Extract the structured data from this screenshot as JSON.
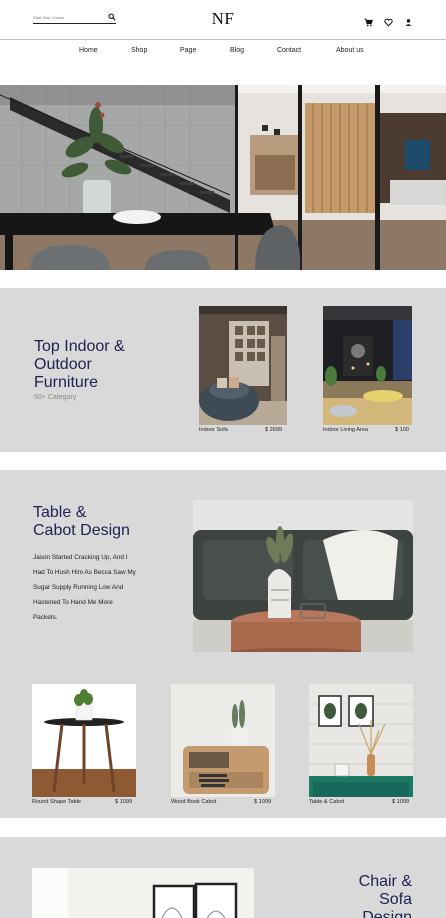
{
  "header": {
    "search_placeholder": "Start Your Choice",
    "logo": "NF",
    "icons": [
      "cart-icon",
      "heart-icon",
      "user-icon"
    ]
  },
  "nav": {
    "items": [
      "Home",
      "Shop",
      "Page",
      "Blog",
      "Contact",
      "About us"
    ]
  },
  "section1": {
    "title_lines": [
      "Top Indoor &",
      "Outdoor",
      "Furniture"
    ],
    "subtitle": "50+ Category",
    "cards": [
      {
        "name": "Indoor Sofa",
        "price": "$ 2699"
      },
      {
        "name": "Indoor Living Area",
        "price": "$ 100"
      }
    ]
  },
  "section2": {
    "title_lines": [
      "Table &",
      "Cabot Design"
    ],
    "paragraph_lines": [
      "Jason Started Cracking Up, And I",
      "Had To Hush Him As Becca Saw My",
      "Sugar Supply Running Low And",
      "Hastened To Hand Me More",
      "Packets."
    ],
    "cards": [
      {
        "name": "Round Shape Table",
        "price": "$ 1099"
      },
      {
        "name": "Wood Book Cabot",
        "price": "$ 1099"
      },
      {
        "name": "Table & Cabot",
        "price": "$ 1099"
      }
    ]
  },
  "section3": {
    "title_lines": [
      "Chair &",
      "Sofa",
      "Design"
    ]
  },
  "colors": {
    "heading": "#1e2152",
    "section_bg": "#d9d9d9",
    "accent_green": "#1d7a62"
  }
}
